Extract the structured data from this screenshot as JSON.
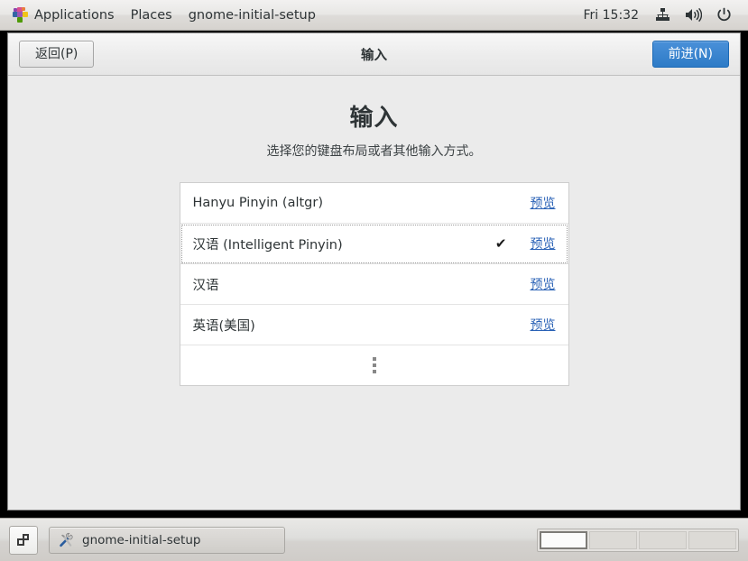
{
  "panel": {
    "app_icon": "applications-pinwheel-icon",
    "menus": [
      {
        "label": "Applications",
        "name": "panel-menu-applications"
      },
      {
        "label": "Places",
        "name": "panel-menu-places"
      },
      {
        "label": "gnome-initial-setup",
        "name": "panel-menu-window-title"
      }
    ],
    "clock": "Fri 15:32",
    "tray": [
      {
        "name": "network-icon"
      },
      {
        "name": "volume-icon"
      },
      {
        "name": "power-icon"
      }
    ]
  },
  "window": {
    "header": {
      "back_label": "返回(P)",
      "title": "输入",
      "next_label": "前进(N)",
      "next_color": "#3a7fc4"
    },
    "page": {
      "title": "输入",
      "subtitle": "选择您的键盘布局或者其他输入方式。"
    },
    "input_sources": [
      {
        "label": "Hanyu Pinyin (altgr)",
        "selected": false,
        "preview_label": "预览"
      },
      {
        "label": "汉语 (Intelligent Pinyin)",
        "selected": true,
        "preview_label": "预览"
      },
      {
        "label": "汉语",
        "selected": false,
        "preview_label": "预览"
      },
      {
        "label": "英语(美国)",
        "selected": false,
        "preview_label": "预览"
      }
    ],
    "more_row": {
      "name": "more-input-sources-row"
    },
    "check_glyph": "✔",
    "link_color": "#2a62b6"
  },
  "taskbar": {
    "show_desktop": "show-desktop-button",
    "task_label": "gnome-initial-setup",
    "task_icon": "tools-icon",
    "workspaces": [
      {
        "active": true
      },
      {
        "active": false
      },
      {
        "active": false
      },
      {
        "active": false
      }
    ]
  }
}
